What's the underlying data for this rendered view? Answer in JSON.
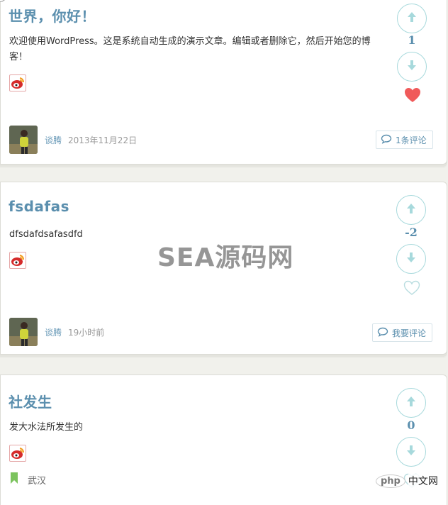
{
  "posts": [
    {
      "title": "世界，你好！",
      "excerpt": "欢迎使用WordPress。这是系统自动生成的演示文章。编辑或者删除它，然后开始您的博客！",
      "author": "谈腾",
      "date": "2013年11月22日",
      "comment_label": "1条评论",
      "vote_count": "1",
      "liked": true
    },
    {
      "title": "fsdafas",
      "excerpt": "dfsdafdsafasdfd",
      "author": "谈腾",
      "date": "19小时前",
      "comment_label": "我要评论",
      "vote_count": "-2",
      "liked": false
    },
    {
      "title": "社发生",
      "excerpt": "发大水法所发生的",
      "location": "武汉",
      "vote_count": "0",
      "liked": false
    }
  ],
  "watermark": "SEA源码网",
  "badge": {
    "logo": "php",
    "text": "中文网"
  },
  "colors": {
    "title": "#5b8fae",
    "vote_circle": "#a7d9dc",
    "heart_filled": "#f05a5a",
    "heart_outline": "#b9dde0"
  }
}
